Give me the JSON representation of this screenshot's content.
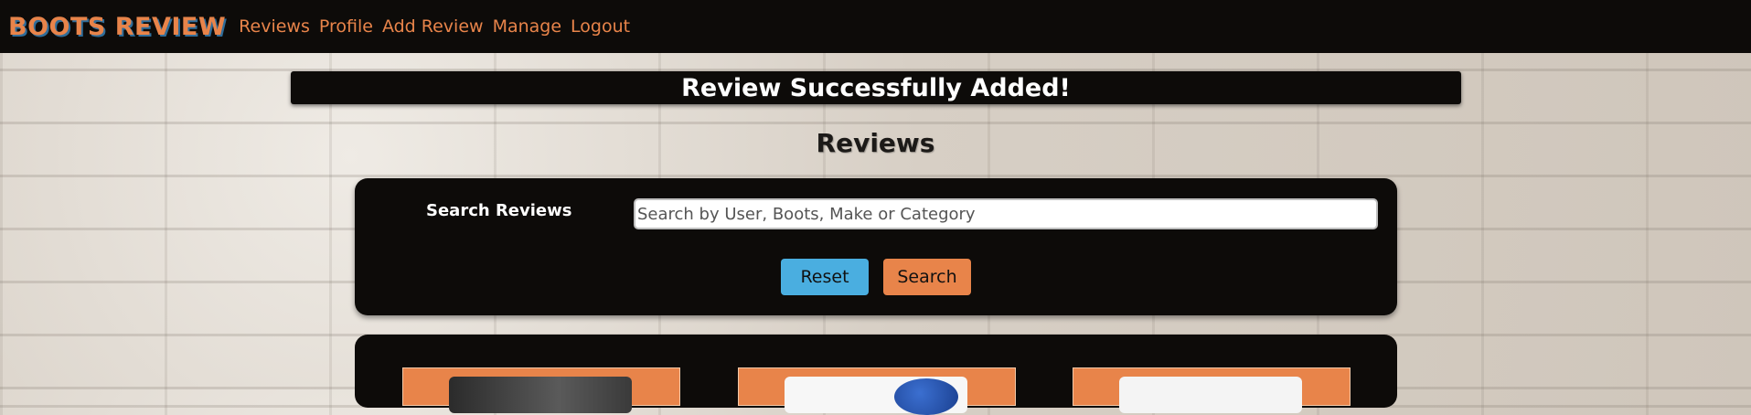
{
  "navbar": {
    "brand": "BOOTS REVIEW",
    "links": [
      "Reviews",
      "Profile",
      "Add Review",
      "Manage",
      "Logout"
    ]
  },
  "alert": {
    "message": "Review Successfully Added!"
  },
  "page": {
    "title": "Reviews"
  },
  "search": {
    "label": "Search Reviews",
    "placeholder": "Search by User, Boots, Make or Category",
    "reset_label": "Reset",
    "search_label": "Search"
  },
  "colors": {
    "accent_orange": "#e8844a",
    "accent_blue": "#4aaee0",
    "panel_black": "#0d0b09"
  }
}
